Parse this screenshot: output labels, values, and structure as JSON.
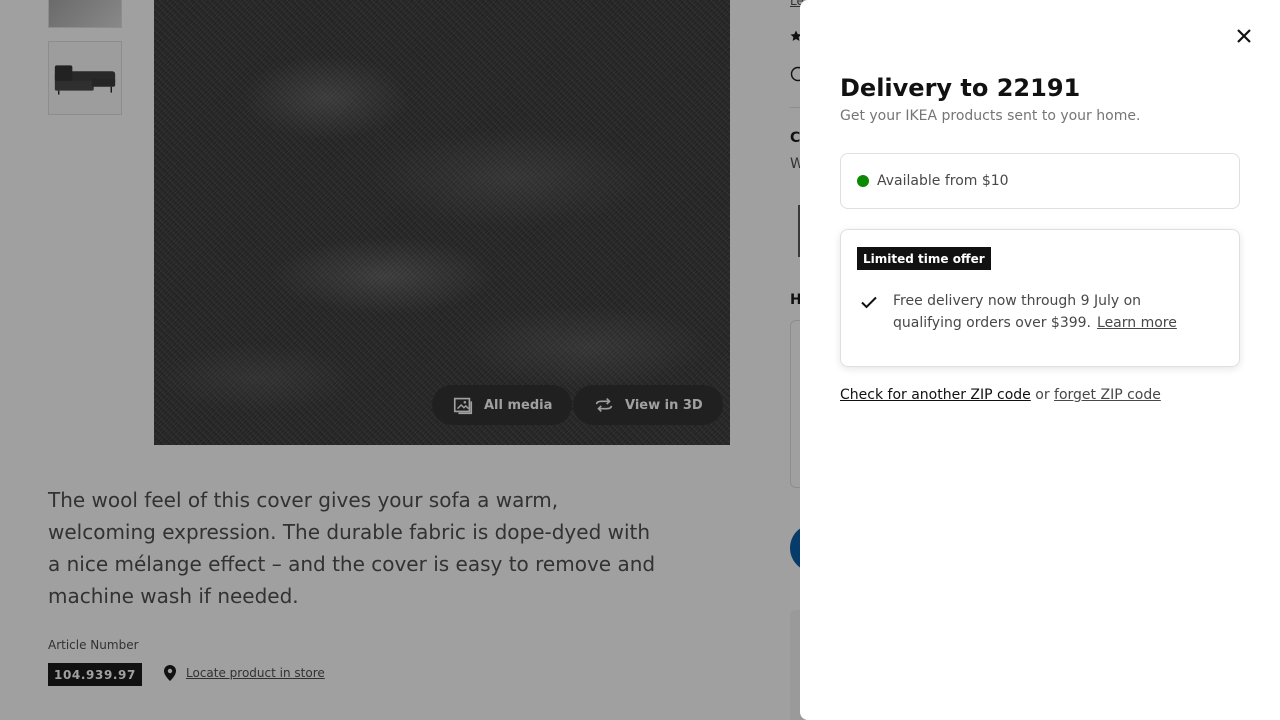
{
  "product": {
    "media_buttons": {
      "all_media": "All media",
      "view_3d": "View in 3D"
    },
    "description": "The wool feel of this cover gives your sofa a warm, welcoming expression. The durable fabric is dope-dyed with a nice mélange effect – and the cover is easy to remove and machine wash if needed.",
    "article_label": "Article Number",
    "article_number": "104.939.97",
    "locate_link": "Locate product in store",
    "side_fragments": {
      "link": "Le",
      "c_label": "C",
      "w_label": "W",
      "h_label": "H"
    }
  },
  "modal": {
    "title": "Delivery to 22191",
    "subtitle": "Get your IKEA products sent to your home.",
    "availability": {
      "text": "Available from $10",
      "status_color": "#0a8a00"
    },
    "offer": {
      "badge": "Limited time offer",
      "text": "Free delivery now through 9 July on qualifying orders over $399.",
      "link": "Learn more"
    },
    "zip": {
      "check_link": "Check for another ZIP code",
      "or": " or ",
      "forget_link": "forget ZIP code"
    }
  },
  "icons": {
    "close": "close-icon",
    "check": "checkmark-icon",
    "location": "location-pin-icon",
    "media": "image-gallery-icon",
    "rotate": "rotate-3d-icon"
  }
}
